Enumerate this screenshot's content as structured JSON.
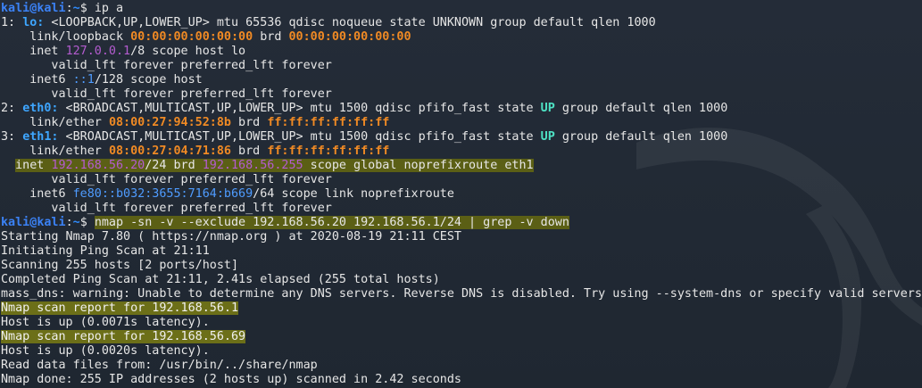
{
  "terminal": {
    "user": "kali",
    "host": "kali",
    "path": "~",
    "prompt_symbol": "$",
    "commands": {
      "cmd1": "ip a",
      "cmd2": "nmap -sn -v --exclude 192.168.56.20 192.168.56.1/24 | grep -v down"
    },
    "lines": {
      "l1": {
        "prefix": "1: ",
        "iface": "lo:",
        "text": " <LOOPBACK,UP,LOWER_UP> mtu 65536 qdisc noqueue state UNKNOWN group default qlen 1000"
      },
      "l2": {
        "text1": "    link/loopback ",
        "mac1": "00:00:00:00:00:00",
        "text2": " brd ",
        "mac2": "00:00:00:00:00:00"
      },
      "l3": {
        "text1": "    inet ",
        "ip": "127.0.0.1",
        "text2": "/8 scope host lo"
      },
      "l4": "       valid_lft forever preferred_lft forever",
      "l5": {
        "text1": "    inet6 ",
        "ip": "::1",
        "text2": "/128 scope host"
      },
      "l6": "       valid_lft forever preferred_lft forever",
      "l7": {
        "prefix": "2: ",
        "iface": "eth0:",
        "text1": " <BROADCAST,MULTICAST,UP,LOWER_UP> mtu 1500 qdisc pfifo_fast state ",
        "state": "UP",
        "text2": " group default qlen 1000"
      },
      "l8": {
        "text1": "    link/ether ",
        "mac1": "08:00:27:94:52:8b",
        "text2": " brd ",
        "mac2": "ff:ff:ff:ff:ff:ff"
      },
      "l9": {
        "prefix": "3: ",
        "iface": "eth1:",
        "text1": " <BROADCAST,MULTICAST,UP,LOWER_UP> mtu 1500 qdisc pfifo_fast state ",
        "state": "UP",
        "text2": " group default qlen 1000"
      },
      "l10": {
        "text1": "    link/ether ",
        "mac1": "08:00:27:04:71:86",
        "text2": " brd ",
        "mac2": "ff:ff:ff:ff:ff:ff"
      },
      "l11": {
        "text1": "inet ",
        "ip": "192.168.56.20",
        "text2": "/24 brd ",
        "brd": "192.168.56.255",
        "text3": " scope global noprefixroute eth1"
      },
      "l12": "       valid_lft forever preferred_lft forever",
      "l13": {
        "text1": "    inet6 ",
        "ip": "fe80::b032:3655:7164:b669",
        "text2": "/64 scope link noprefixroute"
      },
      "l14": "       valid_lft forever preferred_lft forever",
      "l16": "Starting Nmap 7.80 ( https://nmap.org ) at 2020-08-19 21:11 CEST",
      "l17": "Initiating Ping Scan at 21:11",
      "l18": "Scanning 255 hosts [2 ports/host]",
      "l19": "Completed Ping Scan at 21:11, 2.41s elapsed (255 total hosts)",
      "l20": "mass_dns: warning: Unable to determine any DNS servers. Reverse DNS is disabled. Try using --system-dns or specify valid servers with --dns-servers",
      "l21": "Nmap scan report for 192.168.56.1",
      "l22": "Host is up (0.0071s latency).",
      "l23": "Nmap scan report for 192.168.56.69",
      "l24": "Host is up (0.0020s latency).",
      "l25": "Read data files from: /usr/bin/../share/nmap",
      "l26": "Nmap done: 255 IP addresses (2 hosts up) scanned in 2.42 seconds"
    }
  }
}
